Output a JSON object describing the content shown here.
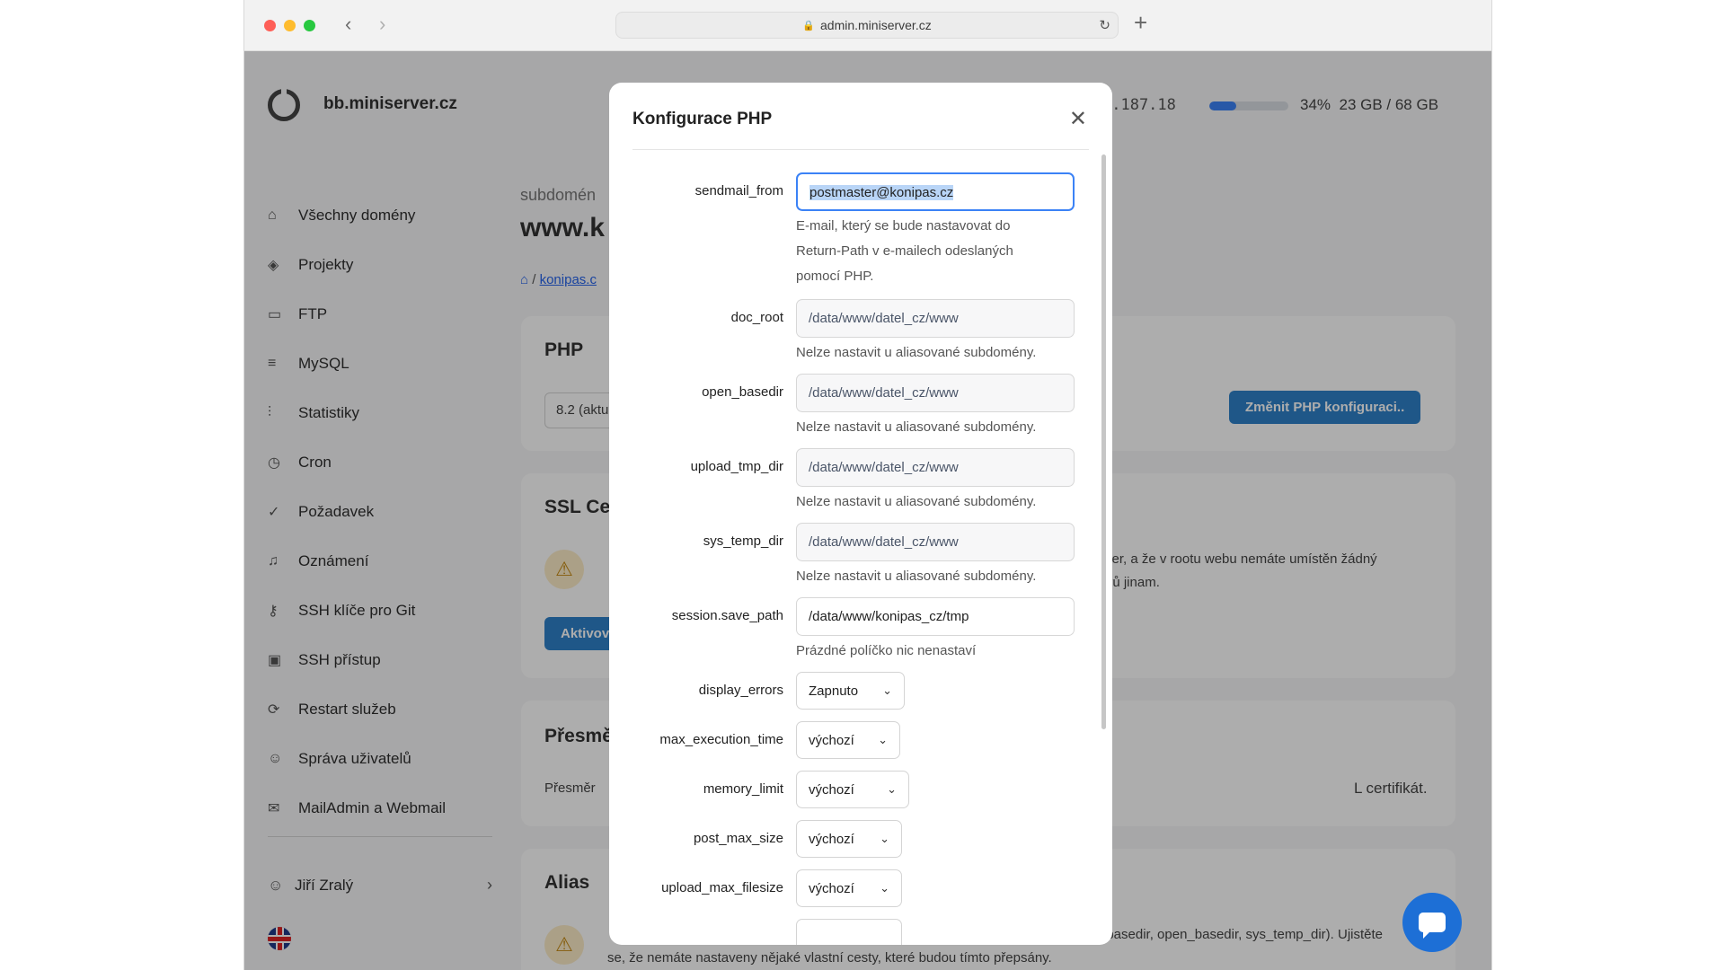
{
  "browser": {
    "url": "admin.miniserver.cz",
    "back_icon": "‹",
    "forward_icon": "›",
    "new_tab_icon": "+",
    "reload_icon": "↻",
    "lock_icon": "🔒"
  },
  "header": {
    "hostname": "bb.miniserver.cz",
    "ip_fragment": "1.187.18",
    "disk_usage_percent": 34,
    "disk_usage_label": "34%",
    "disk_usage_text": "23 GB / 68 GB"
  },
  "sidebar": {
    "items": [
      {
        "label": "Všechny domény",
        "icon": "⌂"
      },
      {
        "label": "Projekty",
        "icon": "◈"
      },
      {
        "label": "FTP",
        "icon": "▭"
      },
      {
        "label": "MySQL",
        "icon": "≡"
      },
      {
        "label": "Statistiky",
        "icon": "⫶"
      },
      {
        "label": "Cron",
        "icon": "◷"
      },
      {
        "label": "Požadavek",
        "icon": "✓"
      },
      {
        "label": "Oznámení",
        "icon": "♫"
      },
      {
        "label": "SSH klíče pro Git",
        "icon": "⚷"
      },
      {
        "label": "SSH přístup",
        "icon": "▣"
      },
      {
        "label": "Restart služeb",
        "icon": "⟳"
      },
      {
        "label": "Správa uživatelů",
        "icon": "☺"
      },
      {
        "label": "MailAdmin a Webmail",
        "icon": "✉"
      }
    ],
    "user_name": "Jiří Zralý",
    "user_icon": "☺",
    "chevron": "›"
  },
  "main": {
    "subdomain_label": "subdomén",
    "subdomain_name": "www.k",
    "breadcrumb_home": "⌂",
    "breadcrumb_sep": " / ",
    "breadcrumb_link": "konipas.c",
    "php_card": {
      "title": "PHP",
      "version_select": "8.2 (aktu",
      "change_button": "Změnit PHP konfiguraci.."
    },
    "ssl_card": {
      "title": "SSL Ce",
      "text_line1": "rver, a že v rootu webu nemáte umístěn žádný",
      "text_line2": "orů jinam.",
      "button": "Aktivov",
      "warn_icon": "⚠"
    },
    "redirect_card": {
      "title": "Přesmě",
      "text_left": "Přesměr",
      "text_right": "L certifikát."
    },
    "alias_card": {
      "title": "Alias",
      "text_line1": "_basedir, open_basedir, sys_temp_dir). Ujistěte",
      "text_line2": "se, že nemáte nastaveny nějaké vlastní cesty, které budou tímto přepsány.",
      "warn_icon": "⚠"
    }
  },
  "modal": {
    "title": "Konfigurace PHP",
    "close_icon": "✕",
    "fields": {
      "sendmail_from": {
        "label": "sendmail_from",
        "value": "postmaster@konipas.cz",
        "help1": "E-mail, který se bude nastavovat do",
        "help2": "Return-Path v e-mailech odeslaných",
        "help3": "pomocí PHP."
      },
      "doc_root": {
        "label": "doc_root",
        "value": "/data/www/datel_cz/www",
        "help": "Nelze nastavit u aliasované subdomény."
      },
      "open_basedir": {
        "label": "open_basedir",
        "value": "/data/www/datel_cz/www",
        "help": "Nelze nastavit u aliasované subdomény."
      },
      "upload_tmp_dir": {
        "label": "upload_tmp_dir",
        "value": "/data/www/datel_cz/www",
        "help": "Nelze nastavit u aliasované subdomény."
      },
      "sys_temp_dir": {
        "label": "sys_temp_dir",
        "value": "/data/www/datel_cz/www",
        "help": "Nelze nastavit u aliasované subdomény."
      },
      "session_save_path": {
        "label": "session.save_path",
        "value": "/data/www/konipas_cz/tmp",
        "help": "Prázdné políčko nic nenastaví"
      },
      "display_errors": {
        "label": "display_errors",
        "value": "Zapnuto"
      },
      "max_execution_time": {
        "label": "max_execution_time",
        "value": "výchozí"
      },
      "memory_limit": {
        "label": "memory_limit",
        "value": "výchozí"
      },
      "post_max_size": {
        "label": "post_max_size",
        "value": "výchozí"
      },
      "upload_max_filesize": {
        "label": "upload_max_filesize",
        "value": "výchozí"
      }
    },
    "dropdown_chevron": "⌄"
  },
  "colors": {
    "accent": "#3b82f6",
    "button_blue": "#2f80c9",
    "chat_button": "#1d6fd6"
  }
}
